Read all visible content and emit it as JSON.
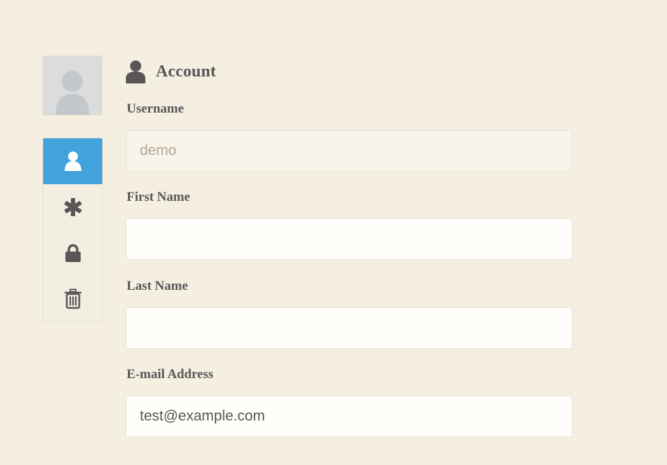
{
  "sidebar": {
    "items": [
      {
        "icon": "user-icon",
        "active": true
      },
      {
        "icon": "asterisk-icon",
        "active": false
      },
      {
        "icon": "lock-icon",
        "active": false
      },
      {
        "icon": "trash-icon",
        "active": false
      }
    ]
  },
  "account": {
    "title": "Account",
    "icon": "user-icon"
  },
  "form": {
    "username": {
      "label": "Username",
      "value": "demo"
    },
    "first_name": {
      "label": "First Name",
      "value": ""
    },
    "last_name": {
      "label": "Last Name",
      "value": ""
    },
    "email": {
      "label": "E-mail Address",
      "value": "test@example.com"
    }
  },
  "colors": {
    "background": "#f5efe1",
    "accent": "#42a3dc",
    "text": "#5a5557"
  }
}
